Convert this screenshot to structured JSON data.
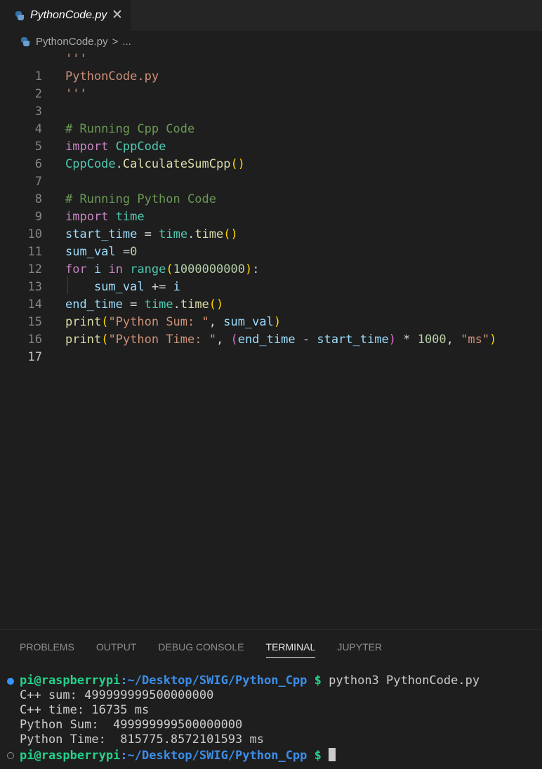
{
  "tab": {
    "title": "PythonCode.py",
    "close": "✕",
    "icon": "python-icon"
  },
  "breadcrumb": {
    "file": "PythonCode.py",
    "separator": ">",
    "more": "..."
  },
  "editor": {
    "line_numbers": [
      "1",
      "2",
      "3",
      "4",
      "5",
      "6",
      "7",
      "8",
      "9",
      "10",
      "11",
      "12",
      "13",
      "14",
      "15",
      "16",
      "17"
    ],
    "active_line": "17"
  },
  "panel": {
    "tabs": [
      "PROBLEMS",
      "OUTPUT",
      "DEBUG CONSOLE",
      "TERMINAL",
      "JUPYTER"
    ],
    "active_tab": "TERMINAL"
  },
  "terminal": {
    "prompt_user": "pi@raspberrypi",
    "prompt_path": ":~/Desktop/SWIG/Python_Cpp",
    "prompt_symbol": "$",
    "command": " python3 PythonCode.py",
    "output": [
      "C++ sum: 499999999500000000",
      "C++ time: 16735 ms",
      "Python Sum:  499999999500000000",
      "Python Time:  815775.8572101593 ms"
    ]
  },
  "colors": {
    "string": "#ce9178",
    "comment": "#6a9955",
    "keyword": "#c586c0",
    "module": "#4ec9b0",
    "function": "#dcdcaa",
    "variable": "#9cdcfe",
    "number": "#b5cea8",
    "prompt_user": "#23d18b",
    "prompt_path": "#3b8eea"
  }
}
